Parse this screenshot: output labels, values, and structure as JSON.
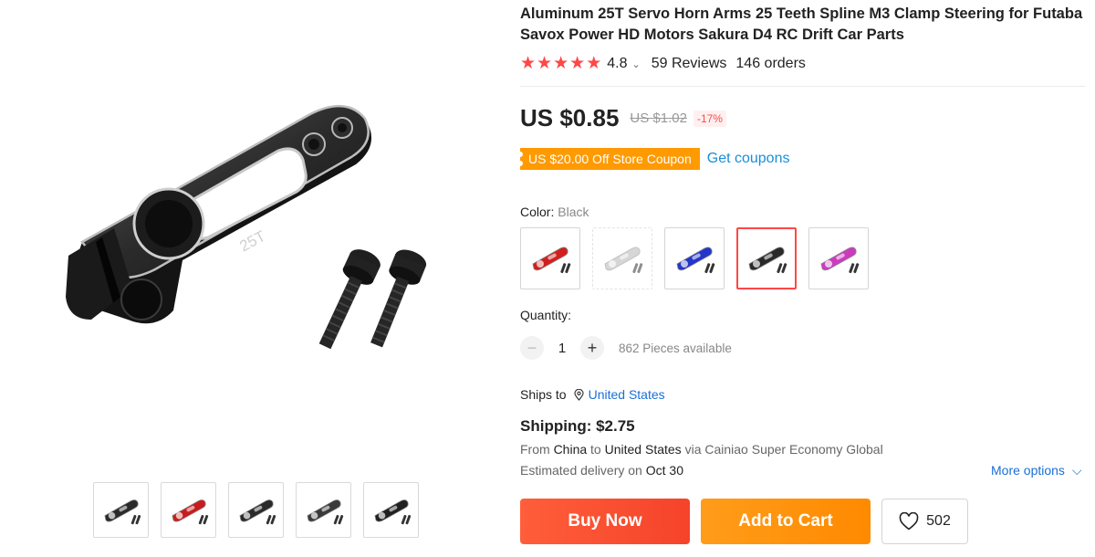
{
  "product": {
    "title": "Aluminum 25T Servo Horn Arms 25 Teeth Spline M3 Clamp Steering for Futaba Savox Power HD Motors Sakura D4 RC Drift Car Parts",
    "rating": "4.8",
    "reviews": "59 Reviews",
    "orders": "146 orders",
    "price": "US $0.85",
    "original_price": "US $1.02",
    "discount": "-17%",
    "arm_marking": "25T"
  },
  "coupon": {
    "tag": "US $20.00 Off Store Coupon",
    "link": "Get coupons"
  },
  "color": {
    "label": "Color:",
    "selected": "Black",
    "options": [
      {
        "name": "red",
        "hex": "#d11f1f",
        "disabled": false,
        "selected": false
      },
      {
        "name": "silver",
        "hex": "#b5b5b5",
        "disabled": true,
        "selected": false
      },
      {
        "name": "blue",
        "hex": "#2436c9",
        "disabled": false,
        "selected": false
      },
      {
        "name": "black",
        "hex": "#2a2a2a",
        "disabled": false,
        "selected": true
      },
      {
        "name": "purple",
        "hex": "#cc3bbf",
        "disabled": false,
        "selected": false
      }
    ]
  },
  "quantity": {
    "label": "Quantity:",
    "value": "1",
    "minus": "−",
    "plus": "+",
    "available": "862 Pieces available"
  },
  "shipping": {
    "ships_to_label": "Ships to",
    "country": "United States",
    "price": "Shipping: $2.75",
    "from_prefix": "From",
    "from_country": "China",
    "to_word": "to",
    "to_country": "United States",
    "via": "via Cainiao Super Economy Global",
    "estimate_prefix": "Estimated delivery on",
    "estimate_date": "Oct 30",
    "more_options": "More options"
  },
  "actions": {
    "buy_now": "Buy Now",
    "add_to_cart": "Add to Cart",
    "wishlist_count": "502"
  },
  "gallery": {
    "thumbnails": [
      {
        "name": "black-arm",
        "hex": "#2a2a2a"
      },
      {
        "name": "red-black-arms",
        "hex": "#c81d1d"
      },
      {
        "name": "black-arm-top",
        "hex": "#2a2a2a"
      },
      {
        "name": "black-arm-side",
        "hex": "#3a3a3a"
      },
      {
        "name": "black-arm-angle",
        "hex": "#202020"
      }
    ]
  },
  "colors": {
    "accent_red": "#ff4747",
    "link_blue": "#1a6fd6",
    "coupon_orange": "#ff9a00",
    "buy_now": "#f5432a",
    "add_to_cart": "#ff8a00"
  }
}
